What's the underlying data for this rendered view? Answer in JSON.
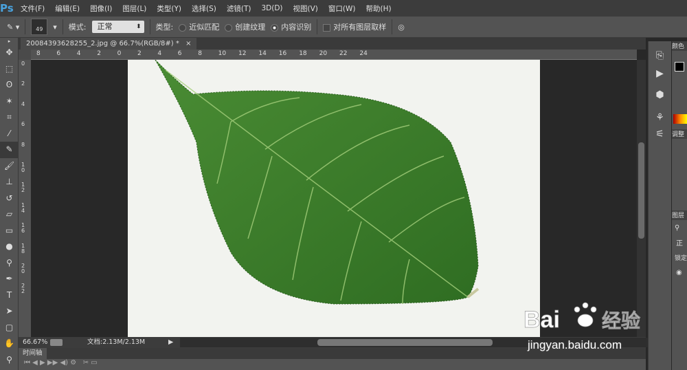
{
  "app_logo": "Ps",
  "menu": [
    "文件(F)",
    "编辑(E)",
    "图像(I)",
    "图层(L)",
    "类型(Y)",
    "选择(S)",
    "滤镜(T)",
    "3D(D)",
    "视图(V)",
    "窗口(W)",
    "帮助(H)"
  ],
  "options": {
    "brush_size": "49",
    "mode_label": "模式:",
    "mode_value": "正常",
    "type_label": "类型:",
    "radio_1": "近似匹配",
    "radio_2": "创建纹理",
    "radio_3": "内容识别",
    "selected_radio": "内容识别",
    "sample_all_layers": "对所有图层取样",
    "sample_all_checked": false
  },
  "document_tab": {
    "title": "20084393628255_2.jpg @ 66.7%(RGB/8#) *",
    "close": "×"
  },
  "ruler_h": [
    "8",
    "6",
    "4",
    "2",
    "0",
    "2",
    "4",
    "6",
    "8",
    "10",
    "12",
    "14",
    "16",
    "18",
    "20",
    "22",
    "24"
  ],
  "ruler_v": [
    "0",
    "2",
    "4",
    "6",
    "8",
    "10",
    "12",
    "14",
    "16",
    "18",
    "20",
    "22"
  ],
  "status": {
    "zoom": "66.67%",
    "doc_info": "文档:2.13M/2.13M"
  },
  "timeline": {
    "tab": "时间轴"
  },
  "panels": {
    "color": "颜色",
    "adjust": "调整",
    "layers": "图层",
    "mode": "正",
    "lock": "锁定"
  },
  "watermark": {
    "brand": "Bai du 经验",
    "url": "jingyan.baidu.com"
  },
  "colors": {
    "leaf": "#3d7d2a",
    "canvas_bg": "#f2f3ef",
    "accent": "#4aa3df"
  }
}
